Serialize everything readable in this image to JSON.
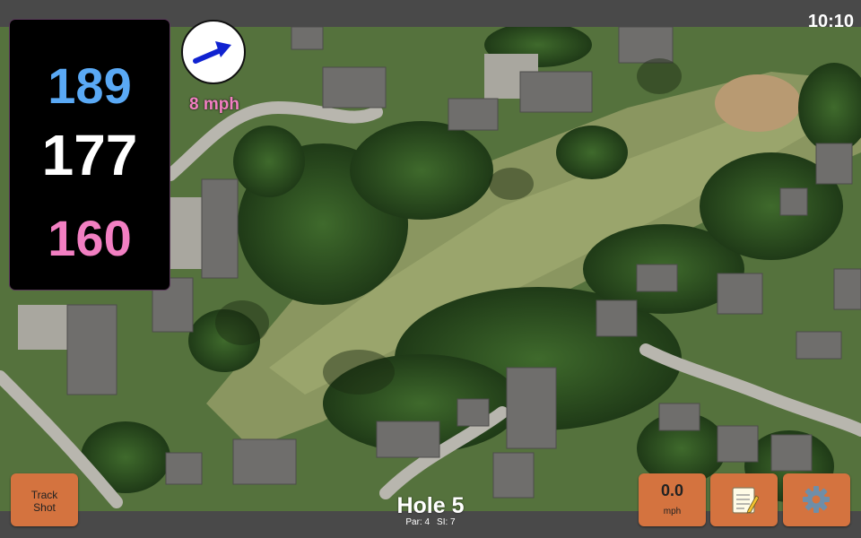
{
  "status_bar": {
    "time": "10:10"
  },
  "distances": {
    "back": "189",
    "middle": "177",
    "front": "160"
  },
  "wind": {
    "speed": "8 mph",
    "direction_icon": "wind-arrow-icon"
  },
  "hole": {
    "title": "Hole 5",
    "par": "Par: 4",
    "si": "SI: 7"
  },
  "buttons": {
    "track_shot": "Track\nShot",
    "speed_value": "0.0",
    "speed_unit": "mph",
    "notes_icon": "notepad-icon",
    "settings_icon": "gear-icon"
  },
  "colors": {
    "back_distance": "#5aa9f5",
    "middle_distance": "#ffffff",
    "front_distance": "#f27fc2",
    "button": "#d4733f",
    "bar": "#494949"
  }
}
